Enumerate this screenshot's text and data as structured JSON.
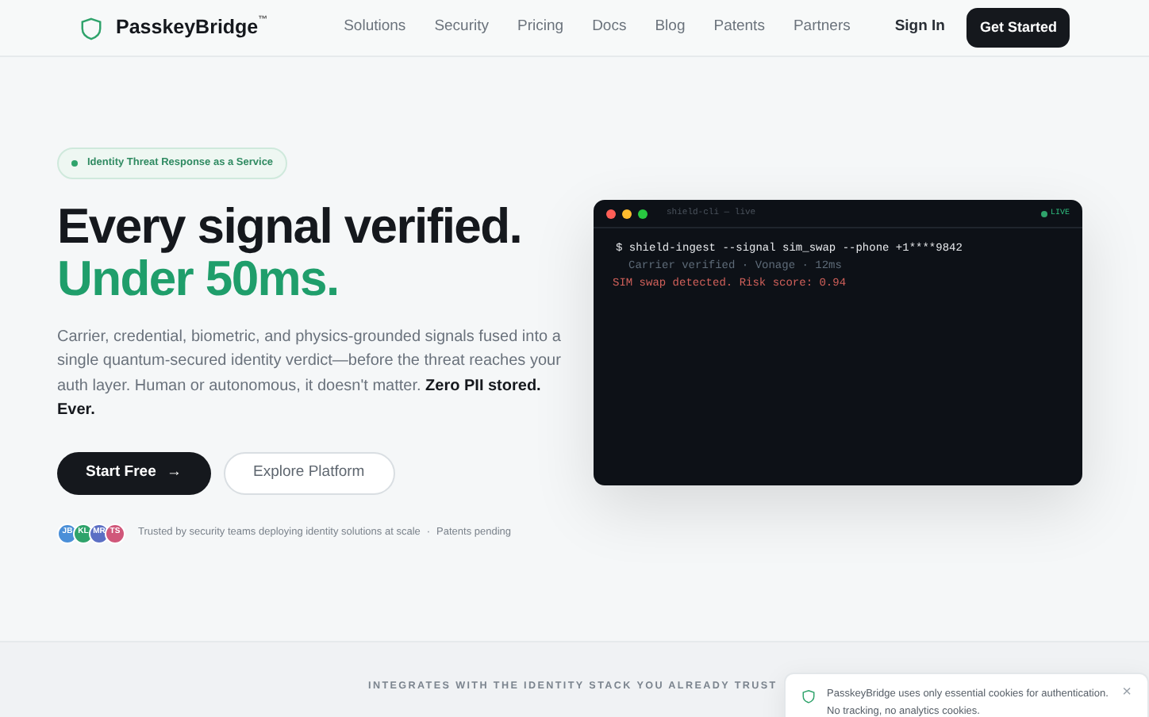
{
  "navbar": {
    "brand": "PasskeyBridge",
    "trademark": "™",
    "links": [
      {
        "label": "Solutions"
      },
      {
        "label": "Security"
      },
      {
        "label": "Pricing"
      },
      {
        "label": "Docs"
      },
      {
        "label": "Blog"
      },
      {
        "label": "Patents"
      },
      {
        "label": "Partners"
      }
    ],
    "sign_in": "Sign In",
    "cta": "Get Started"
  },
  "hero": {
    "pill": "Identity Threat Response as a Service",
    "headline": "Every signal verified.",
    "headline_accent": "Under 50ms.",
    "lede": "Carrier, credential, biometric, and physics-grounded signals fused into a single quantum-secured identity verdict—before the threat reaches your auth layer. Human or autonomous, it doesn't matter. **Zero PII stored. Ever.**",
    "primary_button": "Start Free",
    "primary_arrow": "→",
    "secondary_button": "Explore Platform",
    "avatars": [
      {
        "initials": "JB",
        "color": "#4a8fd8"
      },
      {
        "initials": "KL",
        "color": "#2fa36b"
      },
      {
        "initials": "MR",
        "color": "#5b6fc4"
      },
      {
        "initials": "TS",
        "color": "#d0577a"
      }
    ],
    "trust_text": "Trusted by security teams deploying identity solutions at scale",
    "separator": "·",
    "patents": "Patents pending"
  },
  "terminal": {
    "title": "shield-cli — live",
    "status": "LIVE",
    "lines": [
      {
        "kind": "command",
        "text": "$ shield-ingest --signal sim_swap --phone +1****9842"
      },
      {
        "kind": "info",
        "text": "Carrier verified · Vonage · 12ms"
      },
      {
        "kind": "alert",
        "text": "SIM swap detected. Risk score: 0.94"
      }
    ]
  },
  "integrations": {
    "heading": "INTEGRATES WITH THE IDENTITY STACK YOU ALREADY TRUST"
  },
  "cookie_banner": {
    "text": "PasskeyBridge uses only essential cookies for authentication. No tracking, no analytics cookies.",
    "close": "×"
  }
}
